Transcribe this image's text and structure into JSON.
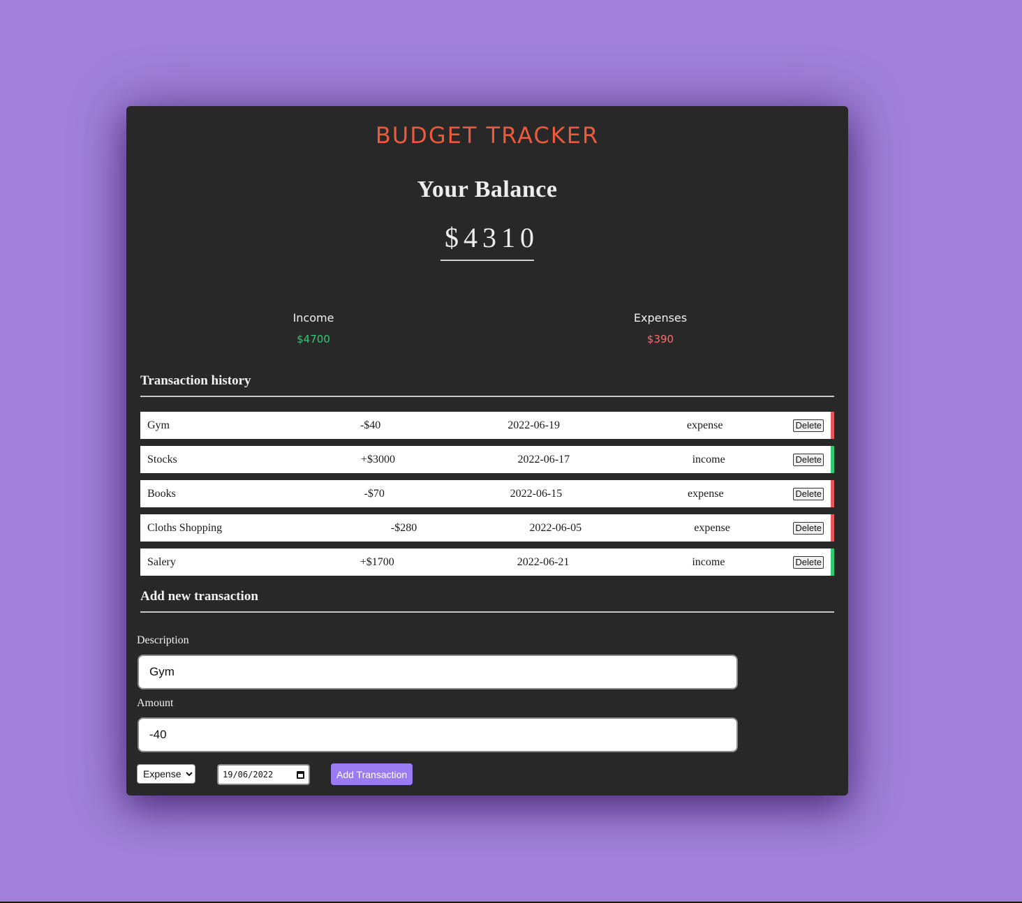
{
  "app": {
    "title": "BUDGET TRACKER"
  },
  "balance": {
    "heading": "Your Balance",
    "value": "$4310"
  },
  "summary": {
    "income_label": "Income",
    "income_value": "$4700",
    "expense_label": "Expenses",
    "expense_value": "$390"
  },
  "history": {
    "heading": "Transaction history",
    "delete_label": "Delete",
    "transactions": [
      {
        "description": "Gym",
        "amount": "-$40",
        "date": "2022-06-19",
        "type": "expense"
      },
      {
        "description": "Stocks",
        "amount": "+$3000",
        "date": "2022-06-17",
        "type": "income"
      },
      {
        "description": "Books",
        "amount": "-$70",
        "date": "2022-06-15",
        "type": "expense"
      },
      {
        "description": "Cloths Shopping",
        "amount": "-$280",
        "date": "2022-06-05",
        "type": "expense"
      },
      {
        "description": "Salery",
        "amount": "+$1700",
        "date": "2022-06-21",
        "type": "income"
      }
    ]
  },
  "form": {
    "heading": "Add new transaction",
    "description_label": "Description",
    "description_value": "Gym",
    "amount_label": "Amount",
    "amount_value": "-40",
    "type_selected": "Expense",
    "date_value": "19/06/2022",
    "submit_label": "Add Transaction"
  },
  "colors": {
    "background": "#a080d9",
    "card": "#282828",
    "title": "#ec5a3e",
    "income": "#2ecc71",
    "expense": "#ff6b6b",
    "accent_button": "#9b7cf0"
  },
  "icons": {
    "date_picker": "calendar-icon",
    "select_arrow": "chevron-down-icon"
  }
}
